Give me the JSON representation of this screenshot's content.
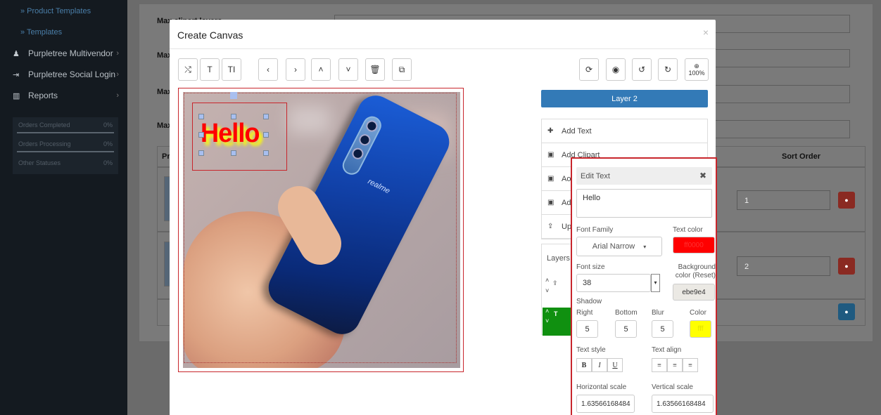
{
  "sidebar": {
    "sub_items": [
      "» Product Templates",
      "» Templates"
    ],
    "items": [
      {
        "label": "Purpletree Multivendor",
        "icon": "users-icon"
      },
      {
        "label": "Purpletree Social Login",
        "icon": "login-icon"
      },
      {
        "label": "Reports",
        "icon": "bar-chart-icon"
      }
    ],
    "stats": [
      {
        "label": "Orders Completed",
        "pct": "0%"
      },
      {
        "label": "Orders Processing",
        "pct": "0%"
      },
      {
        "label": "Other Statuses",
        "pct": "0%"
      }
    ]
  },
  "background": {
    "labels": [
      "Max clipart layers",
      "Max im",
      "Max ico",
      "Max sh"
    ],
    "table_headers": {
      "product": "Produ",
      "sort": "Sort Order"
    },
    "rows": [
      {
        "sort": "1"
      },
      {
        "sort": "2"
      }
    ]
  },
  "modal": {
    "title": "Create Canvas",
    "close": "×",
    "toolbar_left": [
      {
        "icon": "shuffle-icon",
        "glyph": "⤭"
      },
      {
        "icon": "text-icon",
        "glyph": "T"
      },
      {
        "icon": "text-size-icon",
        "glyph": "TI"
      },
      {
        "icon": "chevron-left-icon",
        "glyph": "‹"
      },
      {
        "icon": "chevron-right-icon",
        "glyph": "›"
      },
      {
        "icon": "chevron-up-icon",
        "glyph": "˄"
      },
      {
        "icon": "chevron-down-icon",
        "glyph": "˅"
      },
      {
        "icon": "trash-icon",
        "glyph": "🗑"
      },
      {
        "icon": "copy-icon",
        "glyph": "⧉"
      }
    ],
    "toolbar_right": [
      {
        "icon": "refresh-icon",
        "glyph": "⟳"
      },
      {
        "icon": "eye-icon",
        "glyph": "◉"
      },
      {
        "icon": "undo-icon",
        "glyph": "↺"
      },
      {
        "icon": "redo-icon",
        "glyph": "↻"
      }
    ],
    "zoom": {
      "icon": "zoom-in-icon",
      "glyph": "⊕",
      "value": "100%"
    },
    "canvas": {
      "text": "Hello",
      "brand": "realme",
      "text_color": "#ff0000",
      "shadow_color": "#ffff00"
    },
    "layer_button": "Layer 2",
    "add_list": [
      {
        "label": "Add Text",
        "icon": "plus-circle-icon"
      },
      {
        "label": "Add Clipart",
        "icon": "image-icon"
      },
      {
        "label": "Ao",
        "icon": "image-icon"
      },
      {
        "label": "Ad",
        "icon": "image-icon"
      },
      {
        "label": "Uplo",
        "icon": "upload-icon"
      }
    ],
    "layers_label": "Layers"
  },
  "edit_text": {
    "title": "Edit Text",
    "close": "✖",
    "text_value": "Hello",
    "font_family_label": "Font Family",
    "font_family_value": "Arial Narrow",
    "text_color_label": "Text color",
    "text_color_value": "ff0000",
    "text_color_hex": "#ff0000",
    "font_size_label": "Font size",
    "font_size_value": "38",
    "bg_color_label": "Background color (Reset)",
    "bg_color_value": "ebe9e4",
    "shadow_label": "Shadow",
    "shadow": {
      "right_label": "Right",
      "right": "5",
      "bottom_label": "Bottom",
      "bottom": "5",
      "blur_label": "Blur",
      "blur": "5",
      "color_label": "Color",
      "color": "fff",
      "color_hex": "#ffff00"
    },
    "text_style_label": "Text style",
    "text_style": [
      "B",
      "I",
      "U"
    ],
    "text_align_label": "Text align",
    "text_align": [
      "≡",
      "≡",
      "≡"
    ],
    "h_scale_label": "Horizontal scale",
    "h_scale": "1.63566168484",
    "v_scale_label": "Vertical scale",
    "v_scale": "1.63566168484"
  }
}
